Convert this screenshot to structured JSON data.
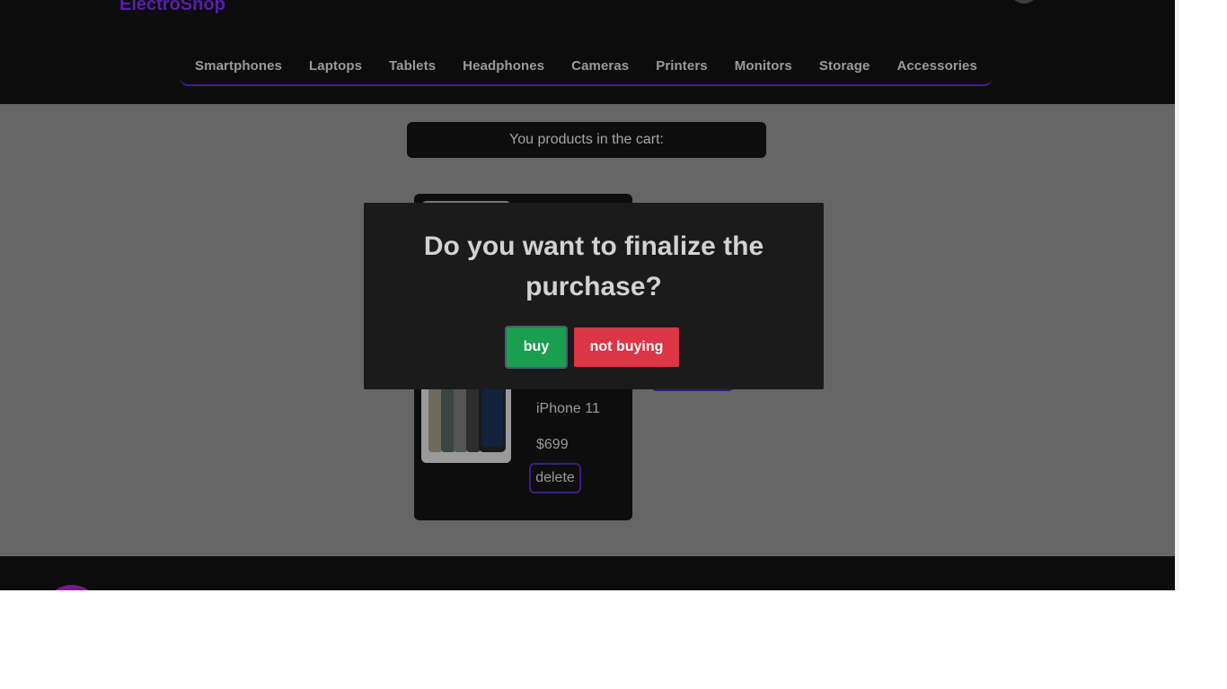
{
  "header": {
    "logo": "ElectroShop",
    "nav": [
      "Smartphones",
      "Laptops",
      "Tablets",
      "Headphones",
      "Cameras",
      "Printers",
      "Monitors",
      "Storage",
      "Accessories"
    ]
  },
  "cart": {
    "title": "You products in the cart:",
    "items": [
      {
        "name": "iPhone 11",
        "price": "$699",
        "delete_label": "delete"
      }
    ]
  },
  "modal": {
    "title": "Do you want to finalize the purchase?",
    "confirm_label": "buy",
    "cancel_label": "not buying"
  },
  "colors": {
    "accent": "#5b1bb0",
    "confirm": "#1a9e4f",
    "cancel": "#dc3545",
    "overlay": "#666666",
    "panel": "#0c0c0c"
  }
}
